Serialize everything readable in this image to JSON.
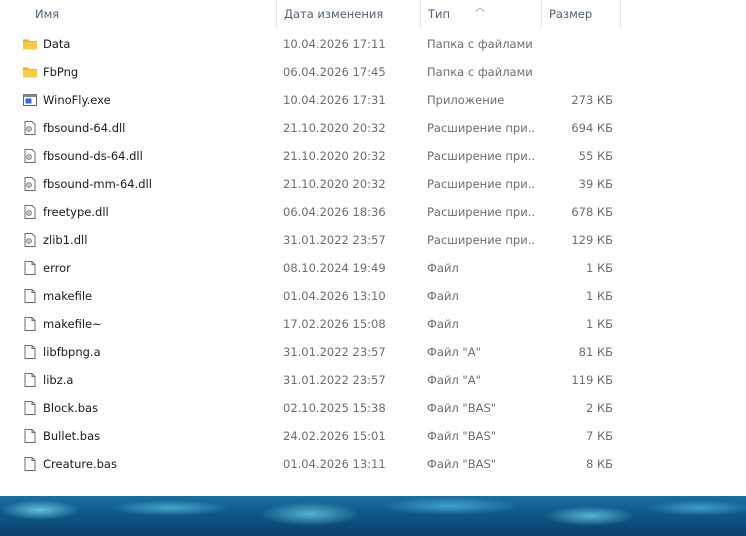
{
  "columns": {
    "name": "Имя",
    "date": "Дата изменения",
    "type": "Тип",
    "size": "Размер"
  },
  "files": [
    {
      "name": "Data",
      "date": "10.04.2026 17:11",
      "type": "Папка с файлами",
      "size": "",
      "icon": "folder"
    },
    {
      "name": "FbPng",
      "date": "06.04.2026 17:45",
      "type": "Папка с файлами",
      "size": "",
      "icon": "folder"
    },
    {
      "name": "WinoFly.exe",
      "date": "10.04.2026 17:31",
      "type": "Приложение",
      "size": "273 КБ",
      "icon": "exe"
    },
    {
      "name": "fbsound-64.dll",
      "date": "21.10.2020 20:32",
      "type": "Расширение при...",
      "size": "694 КБ",
      "icon": "dll"
    },
    {
      "name": "fbsound-ds-64.dll",
      "date": "21.10.2020 20:32",
      "type": "Расширение при...",
      "size": "55 КБ",
      "icon": "dll"
    },
    {
      "name": "fbsound-mm-64.dll",
      "date": "21.10.2020 20:32",
      "type": "Расширение при...",
      "size": "39 КБ",
      "icon": "dll"
    },
    {
      "name": "freetype.dll",
      "date": "06.04.2026 18:36",
      "type": "Расширение при...",
      "size": "678 КБ",
      "icon": "dll"
    },
    {
      "name": "zlib1.dll",
      "date": "31.01.2022 23:57",
      "type": "Расширение при...",
      "size": "129 КБ",
      "icon": "dll"
    },
    {
      "name": "error",
      "date": "08.10.2024 19:49",
      "type": "Файл",
      "size": "1 КБ",
      "icon": "file"
    },
    {
      "name": "makefile",
      "date": "01.04.2026 13:10",
      "type": "Файл",
      "size": "1 КБ",
      "icon": "file"
    },
    {
      "name": "makefile~",
      "date": "17.02.2026 15:08",
      "type": "Файл",
      "size": "1 КБ",
      "icon": "file"
    },
    {
      "name": "libfbpng.a",
      "date": "31.01.2022 23:57",
      "type": "Файл \"A\"",
      "size": "81 КБ",
      "icon": "file"
    },
    {
      "name": "libz.a",
      "date": "31.01.2022 23:57",
      "type": "Файл \"A\"",
      "size": "119 КБ",
      "icon": "file"
    },
    {
      "name": "Block.bas",
      "date": "02.10.2025 15:38",
      "type": "Файл \"BAS\"",
      "size": "2 КБ",
      "icon": "file"
    },
    {
      "name": "Bullet.bas",
      "date": "24.02.2026 15:01",
      "type": "Файл \"BAS\"",
      "size": "7 КБ",
      "icon": "file"
    },
    {
      "name": "Creature.bas",
      "date": "01.04.2026 13:11",
      "type": "Файл \"BAS\"",
      "size": "8 КБ",
      "icon": "file"
    }
  ],
  "colors": {
    "folder": "#f7c948",
    "folder_dark": "#e6a817",
    "exe_blue": "#2b6cc4"
  }
}
